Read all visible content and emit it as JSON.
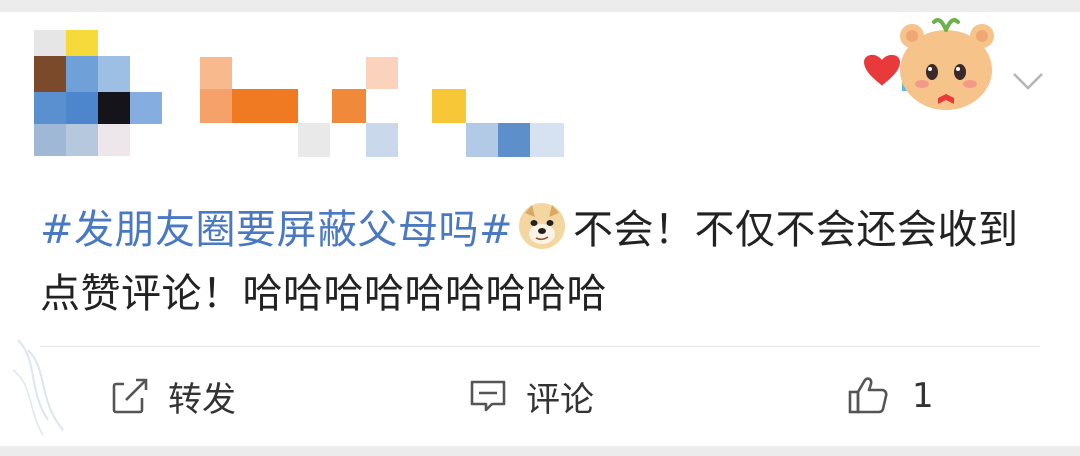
{
  "post": {
    "hashtag": "#发朋友圈要屏蔽父母吗#",
    "emoji": "doge-emoji",
    "body": "不会！不仅不会还会收到点赞评论！哈哈哈哈哈哈哈哈哈"
  },
  "actions": {
    "forward_label": "转发",
    "comment_label": "评论",
    "like_count": "1"
  },
  "colors": {
    "hashtag": "#4a79c2",
    "icon": "#555555",
    "divider": "#e6e6e6"
  },
  "icons": [
    "edit-share-icon",
    "comment-icon",
    "thumbs-up-icon",
    "chevron-down-icon"
  ]
}
